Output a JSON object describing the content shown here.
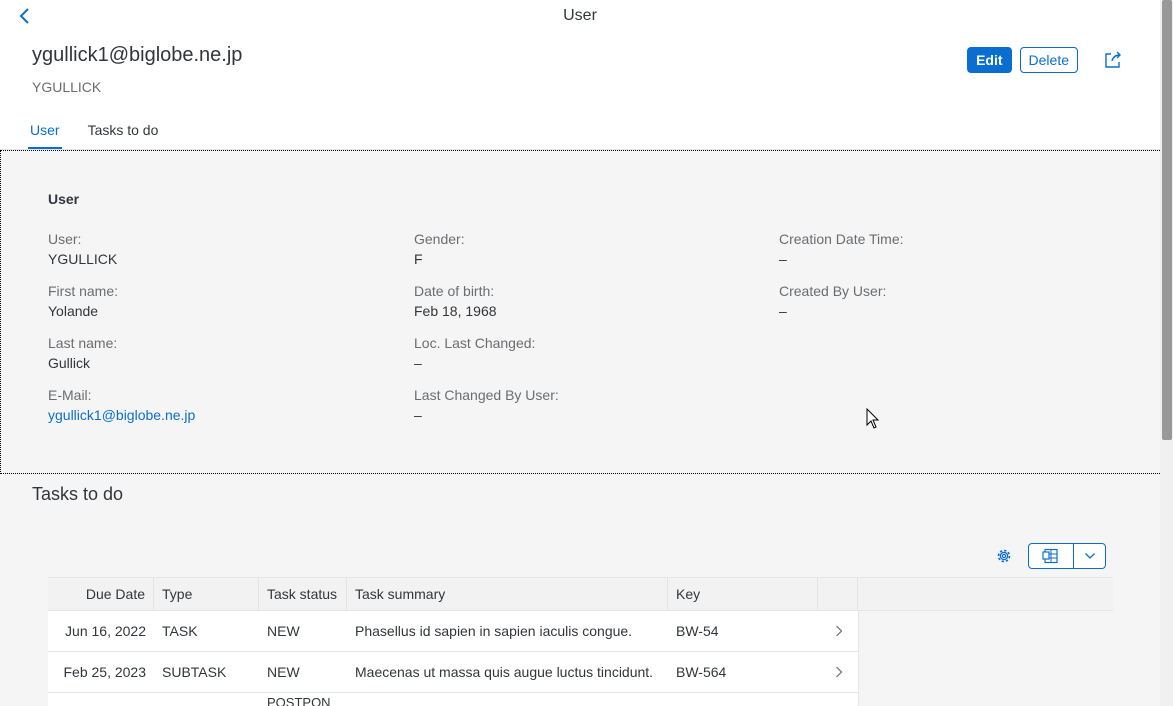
{
  "shell": {
    "title": "User"
  },
  "header": {
    "title": "ygullick1@biglobe.ne.jp",
    "subtitle": "YGULLICK",
    "actions": {
      "edit": "Edit",
      "delete": "Delete"
    },
    "tabs": [
      {
        "label": "User",
        "active": true
      },
      {
        "label": "Tasks to do",
        "active": false
      }
    ]
  },
  "user_section": {
    "title": "User",
    "fields": {
      "user": {
        "label": "User:",
        "value": "YGULLICK"
      },
      "first_name": {
        "label": "First name:",
        "value": "Yolande"
      },
      "last_name": {
        "label": "Last name:",
        "value": "Gullick"
      },
      "email": {
        "label": "E-Mail:",
        "value": "ygullick1@biglobe.ne.jp"
      },
      "gender": {
        "label": "Gender:",
        "value": "F"
      },
      "dob": {
        "label": "Date of birth:",
        "value": "Feb 18, 1968"
      },
      "loc_last_changed": {
        "label": "Loc. Last Changed:",
        "value": "–"
      },
      "last_changed_by": {
        "label": "Last Changed By User:",
        "value": "–"
      },
      "creation_dt": {
        "label": "Creation Date Time:",
        "value": "–"
      },
      "created_by": {
        "label": "Created By User:",
        "value": "–"
      }
    }
  },
  "tasks": {
    "title": "Tasks to do",
    "columns": [
      "Due Date",
      "Type",
      "Task status",
      "Task summary",
      "Key"
    ],
    "rows": [
      {
        "due": "Jun 16, 2022",
        "type": "TASK",
        "status": "NEW",
        "summary": "Phasellus id sapien in sapien iaculis congue.",
        "key": "BW-54"
      },
      {
        "due": "Feb 25, 2023",
        "type": "SUBTASK",
        "status": "NEW",
        "summary": "Maecenas ut massa quis augue luctus tincidunt.",
        "key": "BW-564"
      },
      {
        "due": "",
        "type": "",
        "status": "POSTPON",
        "summary": "",
        "key": ""
      }
    ]
  },
  "colors": {
    "accent": "#0a6ed1",
    "text": "#32363a",
    "label": "#6a6d70",
    "background": "#f5f5f5"
  },
  "icons": {
    "back": "chevron-left-icon",
    "share": "share-icon",
    "settings": "gear-icon",
    "export": "spreadsheet-export-icon",
    "dropdown": "chevron-down-icon",
    "row_nav": "chevron-right-icon"
  }
}
